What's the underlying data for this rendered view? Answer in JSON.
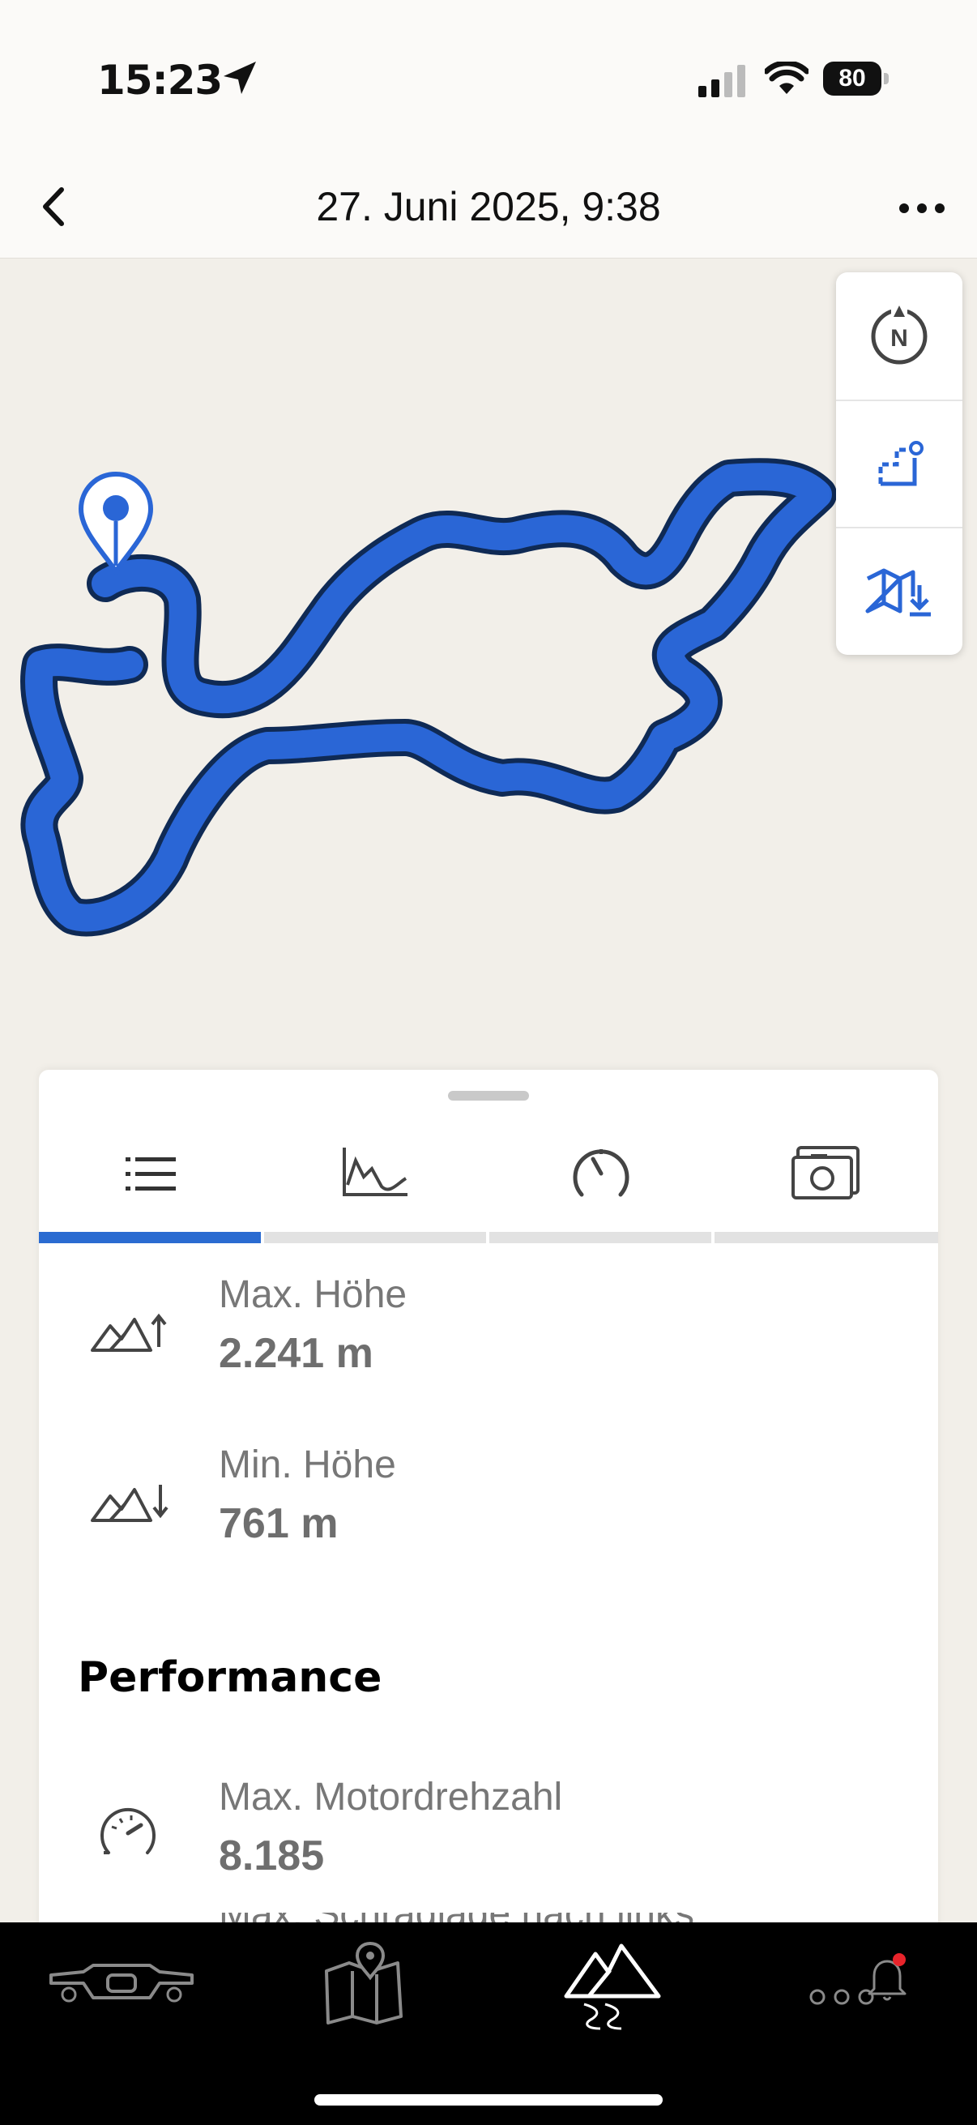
{
  "status_bar": {
    "time": "15:23",
    "battery": "80",
    "location_icon": "location-arrow-icon",
    "signal_icon": "cellular-signal-icon",
    "wifi_icon": "wifi-icon"
  },
  "header": {
    "title": "27. Juni 2025, 9:38",
    "back_icon": "chevron-left-icon",
    "more_icon": "ellipsis-icon"
  },
  "map": {
    "route_color": "#2a66d6",
    "route_outline_color": "#0f2a55",
    "start_pin_icon": "location-pin-icon",
    "controls": [
      {
        "icon": "compass-north-icon"
      },
      {
        "icon": "fit-route-icon"
      },
      {
        "icon": "offline-map-download-icon"
      }
    ]
  },
  "sheet": {
    "tabs": [
      {
        "icon": "list-icon",
        "active": true
      },
      {
        "icon": "elevation-chart-icon",
        "active": false
      },
      {
        "icon": "speedometer-icon",
        "active": false
      },
      {
        "icon": "camera-icon",
        "active": false
      }
    ],
    "stats": [
      {
        "icon": "max-altitude-icon",
        "label": "Max. Höhe",
        "value": "2.241 m"
      },
      {
        "icon": "min-altitude-icon",
        "label": "Min. Höhe",
        "value": "761 m"
      }
    ],
    "section_title": "Performance",
    "performance": [
      {
        "icon": "rpm-gauge-icon",
        "label": "Max. Motordrehzahl",
        "value": "8.185"
      }
    ],
    "cutoff_label": "Max. Schräglage nach links"
  },
  "bottom_nav": {
    "items": [
      {
        "icon": "motorcycle-cockpit-icon"
      },
      {
        "icon": "map-pin-icon"
      },
      {
        "icon": "mountains-road-icon",
        "active": true
      },
      {
        "icon": "more-notifications-icon",
        "badge": true
      }
    ],
    "accent_color": "#e8242b"
  }
}
